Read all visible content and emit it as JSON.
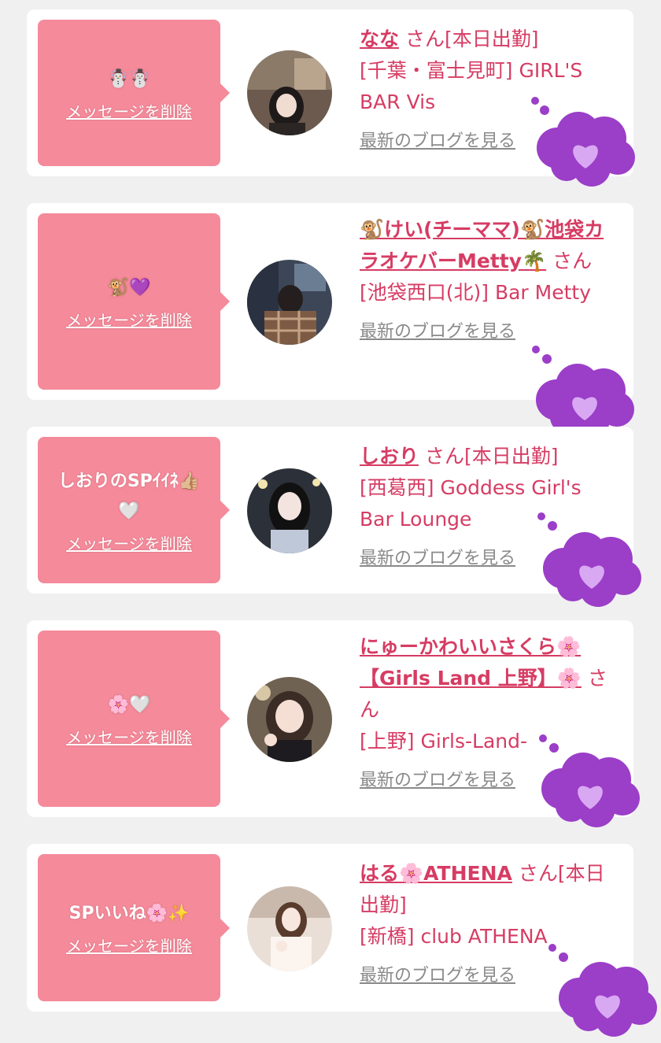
{
  "delete_label": "メッセージを削除",
  "san_label": "さん",
  "blog_label": "最新のブログを見る",
  "colors": {
    "background": "#f0f0f1",
    "card": "#ffffff",
    "bubble": "#f48a9a",
    "name_text": "#d63c63",
    "blog_link": "#8a8a8a",
    "sticker_cloud": "#9b3ec8"
  },
  "cards": [
    {
      "message": "☃️☃️",
      "name": "なな",
      "name_suffix": "さん[本日出勤]",
      "area_shop": "[千葉・富士見町] GIRL'S BAR Vis"
    },
    {
      "message": "🐒💜",
      "name": "🐒けい(チーママ)🐒池袋カラオケバーMetty🌴",
      "name_suffix": "さん",
      "area_shop": "[池袋西口(北)] Bar Metty"
    },
    {
      "message": "しおりのSPｲｲﾈ👍🏼🤍",
      "name": "しおり",
      "name_suffix": "さん[本日出勤]",
      "area_shop": "[西葛西] Goddess Girl's Bar Lounge"
    },
    {
      "message": "🌸🤍",
      "name": "にゅーかわいいさくら🌸【Girls Land 上野】🌸",
      "name_suffix": "さん",
      "area_shop": "[上野] Girls-Land-"
    },
    {
      "message": "SPいいね🌸✨",
      "name": "はる🌸ATHENA",
      "name_suffix": "さん[本日出勤]",
      "area_shop": "[新橋] club ATHENA"
    }
  ]
}
